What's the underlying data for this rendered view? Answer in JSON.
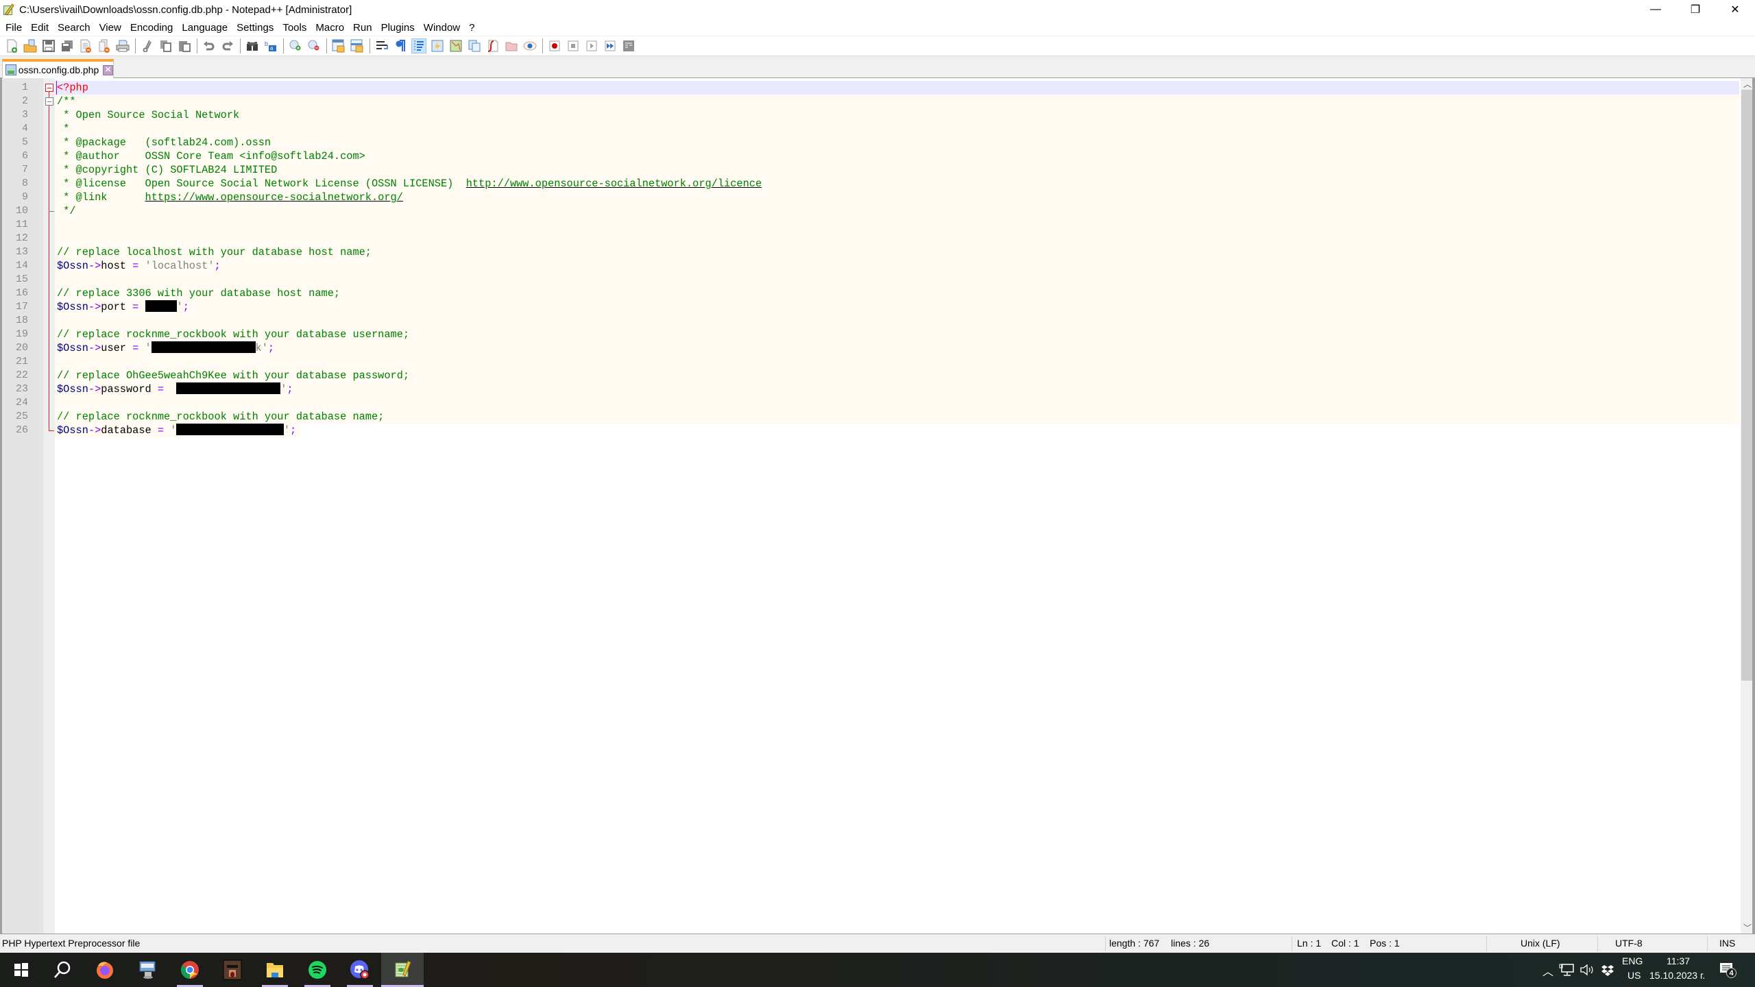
{
  "window": {
    "title": "C:\\Users\\ivail\\Downloads\\ossn.config.db.php - Notepad++ [Administrator]",
    "controls": {
      "minimize": "—",
      "maximize": "❐",
      "close": "✕"
    },
    "menu_close_doc": "X"
  },
  "menu": [
    "File",
    "Edit",
    "Search",
    "View",
    "Encoding",
    "Language",
    "Settings",
    "Tools",
    "Macro",
    "Run",
    "Plugins",
    "Window",
    "?"
  ],
  "toolbar": {
    "groups": [
      [
        "new-file",
        "open-file",
        "save",
        "save-all",
        "close",
        "close-all",
        "print"
      ],
      [
        "cut",
        "copy",
        "paste"
      ],
      [
        "undo",
        "redo"
      ],
      [
        "find",
        "replace"
      ],
      [
        "zoom-in",
        "zoom-out"
      ],
      [
        "sync-vertical-scroll",
        "sync-horizontal-scroll"
      ],
      [
        "word-wrap",
        "show-all-characters",
        "indent-guide",
        "user-defined-language",
        "document-map",
        "document-list",
        "function-list",
        "folder-as-workspace",
        "monitoring"
      ],
      [
        "macro-record",
        "macro-stop",
        "macro-play",
        "macro-run-multiple",
        "macro-save"
      ]
    ],
    "active": [
      "indent-guide"
    ]
  },
  "tabs": [
    {
      "label": "ossn.config.db.php",
      "active": true
    }
  ],
  "editor": {
    "current_line": 1,
    "lines": [
      {
        "n": "1",
        "tokens": [
          {
            "t": "<?php",
            "c": "php"
          }
        ]
      },
      {
        "n": "2",
        "tokens": [
          {
            "t": "/**",
            "c": "com"
          }
        ]
      },
      {
        "n": "3",
        "tokens": [
          {
            "t": " * Open Source Social Network",
            "c": "com"
          }
        ]
      },
      {
        "n": "4",
        "tokens": [
          {
            "t": " *",
            "c": "com"
          }
        ]
      },
      {
        "n": "5",
        "tokens": [
          {
            "t": " * @package   (softlab24.com).ossn",
            "c": "com"
          }
        ]
      },
      {
        "n": "6",
        "tokens": [
          {
            "t": " * @author    OSSN Core Team <info@softlab24.com>",
            "c": "com"
          }
        ]
      },
      {
        "n": "7",
        "tokens": [
          {
            "t": " * @copyright (C) SOFTLAB24 LIMITED",
            "c": "com"
          }
        ]
      },
      {
        "n": "8",
        "tokens": [
          {
            "t": " * @license   Open Source Social Network License (OSSN LICENSE)  ",
            "c": "com"
          },
          {
            "t": "http://www.opensource-socialnetwork.org/licence",
            "c": "link"
          }
        ]
      },
      {
        "n": "9",
        "tokens": [
          {
            "t": " * @link      ",
            "c": "com"
          },
          {
            "t": "https://www.opensource-socialnetwork.org/",
            "c": "link"
          }
        ]
      },
      {
        "n": "10",
        "tokens": [
          {
            "t": " */",
            "c": "com"
          }
        ]
      },
      {
        "n": "11",
        "tokens": []
      },
      {
        "n": "12",
        "tokens": []
      },
      {
        "n": "13",
        "tokens": [
          {
            "t": "// replace localhost with your database host name;",
            "c": "com"
          }
        ]
      },
      {
        "n": "14",
        "tokens": [
          {
            "t": "$Ossn",
            "c": "var"
          },
          {
            "t": "->",
            "c": "op"
          },
          {
            "t": "host",
            "c": "prop"
          },
          {
            "t": " = ",
            "c": "op"
          },
          {
            "t": "'localhost'",
            "c": "str"
          },
          {
            "t": ";",
            "c": "op"
          }
        ]
      },
      {
        "n": "15",
        "tokens": []
      },
      {
        "n": "16",
        "tokens": [
          {
            "t": "// replace 3306 with your database host name;",
            "c": "com"
          }
        ]
      },
      {
        "n": "17",
        "tokens": [
          {
            "t": "$Ossn",
            "c": "var"
          },
          {
            "t": "->",
            "c": "op"
          },
          {
            "t": "port",
            "c": "prop"
          },
          {
            "t": " = ",
            "c": "op"
          },
          {
            "t": "█████",
            "c": "redact",
            "w": 5
          },
          {
            "t": "'",
            "c": "str"
          },
          {
            "t": ";",
            "c": "op"
          }
        ]
      },
      {
        "n": "18",
        "tokens": []
      },
      {
        "n": "19",
        "tokens": [
          {
            "t": "// replace rocknme_rockbook with your database username;",
            "c": "com"
          }
        ]
      },
      {
        "n": "20",
        "tokens": [
          {
            "t": "$Ossn",
            "c": "var"
          },
          {
            "t": "->",
            "c": "op"
          },
          {
            "t": "user",
            "c": "prop"
          },
          {
            "t": " = ",
            "c": "op"
          },
          {
            "t": "'",
            "c": "str"
          },
          {
            "t": "████████████████",
            "c": "redact",
            "w": 16.5
          },
          {
            "t": "k'",
            "c": "str"
          },
          {
            "t": ";",
            "c": "op"
          }
        ]
      },
      {
        "n": "21",
        "tokens": []
      },
      {
        "n": "22",
        "tokens": [
          {
            "t": "// replace OhGee5weahCh9Kee with your database password;",
            "c": "com"
          }
        ]
      },
      {
        "n": "23",
        "tokens": [
          {
            "t": "$Ossn",
            "c": "var"
          },
          {
            "t": "->",
            "c": "op"
          },
          {
            "t": "password",
            "c": "prop"
          },
          {
            "t": " = ",
            "c": "op"
          },
          {
            "t": " ",
            "c": "str"
          },
          {
            "t": "████████████████",
            "c": "redact",
            "w": 16.5
          },
          {
            "t": "'",
            "c": "str"
          },
          {
            "t": ";",
            "c": "op"
          }
        ]
      },
      {
        "n": "24",
        "tokens": []
      },
      {
        "n": "25",
        "tokens": [
          {
            "t": "// replace rocknme_rockbook with your database name;",
            "c": "com"
          }
        ]
      },
      {
        "n": "26",
        "tokens": [
          {
            "t": "$Ossn",
            "c": "var"
          },
          {
            "t": "->",
            "c": "op"
          },
          {
            "t": "database",
            "c": "prop"
          },
          {
            "t": " = ",
            "c": "op"
          },
          {
            "t": "'",
            "c": "str"
          },
          {
            "t": "█████████████████",
            "c": "redact",
            "w": 17
          },
          {
            "t": "'",
            "c": "str"
          },
          {
            "t": ";",
            "c": "op"
          }
        ]
      }
    ],
    "scroll": {
      "visible_fraction": 0.71,
      "position": 0
    }
  },
  "statusbar": {
    "file_type": "PHP Hypertext Preprocessor file",
    "length": "length : 767",
    "lines": "lines : 26",
    "ln": "Ln : 1",
    "col": "Col : 1",
    "pos": "Pos : 1",
    "eol": "Unix (LF)",
    "encoding": "UTF-8",
    "mode": "INS"
  },
  "taskbar": {
    "apps": [
      {
        "name": "start",
        "running": false
      },
      {
        "name": "search",
        "running": false
      },
      {
        "name": "firefox",
        "running": false
      },
      {
        "name": "remote-desktop",
        "running": false
      },
      {
        "name": "chrome",
        "running": true
      },
      {
        "name": "game",
        "running": false
      },
      {
        "name": "file-explorer",
        "running": true
      },
      {
        "name": "spotify",
        "running": true
      },
      {
        "name": "discord",
        "running": true
      },
      {
        "name": "notepad-plus-plus",
        "running": true,
        "active": true
      }
    ],
    "tray": {
      "language_top": "ENG",
      "language_bottom": "US",
      "time": "11:37",
      "date": "15.10.2023 г.",
      "notifications": "4"
    }
  },
  "colors": {
    "tab_accent": "#f7a537",
    "current_line": "#e8e8ff",
    "comment": "#008000",
    "php_tag": "#ff0000",
    "variable": "#000080",
    "operator": "#8000ff",
    "string": "#808080",
    "fold": "#e01b1b"
  }
}
